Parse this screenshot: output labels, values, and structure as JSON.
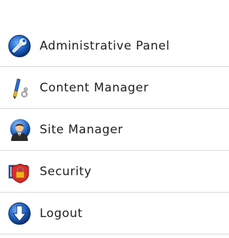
{
  "menu": {
    "items": [
      {
        "label": "Administrative Panel",
        "icon": "wrench-globe-icon"
      },
      {
        "label": "Content Manager",
        "icon": "brush-tools-icon"
      },
      {
        "label": "Site Manager",
        "icon": "user-manager-icon"
      },
      {
        "label": "Security",
        "icon": "security-shield-icon"
      },
      {
        "label": "Logout",
        "icon": "logout-arrow-icon"
      }
    ]
  },
  "colors": {
    "divider": "#d7d7d7",
    "text": "#1f1f1f",
    "accent_blue": "#1c5fbf"
  }
}
